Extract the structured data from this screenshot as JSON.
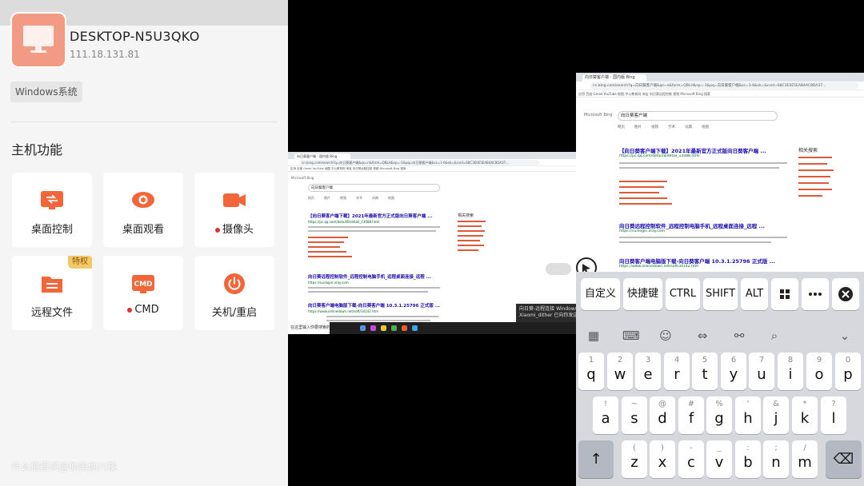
{
  "host": {
    "name": "DESKTOP-N5U3QKO",
    "ip": "111.18.131.81",
    "os_tag": "Windows系统",
    "icon": "monitor-icon"
  },
  "functions": {
    "title": "主机功能",
    "items": [
      {
        "label": "桌面控制",
        "icon": "desktop-control-icon"
      },
      {
        "label": "桌面观看",
        "icon": "eye-icon"
      },
      {
        "label": "摄像头",
        "icon": "camera-icon"
      },
      {
        "label": "远程文件",
        "icon": "folder-icon",
        "badge": "特权"
      },
      {
        "label": "CMD",
        "icon": "cmd-icon"
      },
      {
        "label": "关机/重启",
        "icon": "power-icon"
      }
    ]
  },
  "watermark": "什么值得买@你美你八筷",
  "colors": {
    "accent": "#f2663a",
    "icon_bg": "#f39a84",
    "status_dot": "#e0323a",
    "badge": "#f3c867"
  },
  "desktop": {
    "tab_title": "向日葵客户端 - 国内版 Bing",
    "url": "cn.bing.com/search?q=向日葵客户端&qs=n&form=QBLH&sp=-1&pq=向日葵客户端&sc=1-6&sk=&cvid=68C3E0E5EAB4AC8DA37...",
    "bookmarks": "应用  百度  Gmail  YouTube  地图  中公教育网  淘宝  向日葵远程控制  视频  Microsoft Bing 搜索",
    "engine": "Microsoft Bing",
    "query": "向日葵客户端",
    "nav_tabs": [
      "网页",
      "图片",
      "视频",
      "学术",
      "词典",
      "地图"
    ],
    "results": [
      {
        "title": "【向日葵客户端下载】2021年最新官方正式版向日葵客户端 ...",
        "url": "https://pc.qq.com/detail/8/detail_13088.html"
      },
      {
        "title": "向日葵远程控制软件_远程控制电脑手机_远程桌面连接_远程 ...",
        "url": "https://sunlogin.oray.com"
      },
      {
        "title": "向日葵客户端电脑版下载-向日葵客户端 10.3.1.25796 正式版 ...",
        "url": "https://www.onlinedown.net/soft/34142.htm"
      }
    ],
    "related_heading": "相关搜索",
    "taskbar_search": "在这里输入你要搜索的内容",
    "notify": "向日葵-远程连接 Windows...",
    "notify_sub": "Xiaomi_dither 已向你发送了消息"
  },
  "keyboard": {
    "function_keys": [
      "自定义",
      "快捷键",
      "CTRL",
      "SHIFT",
      "ALT",
      "win-key-icon",
      "more-icon",
      "close-circle-icon"
    ],
    "toolbar_icons": [
      "grid-icon",
      "keyboard-icon",
      "emoji-icon",
      "cursor-move-icon",
      "link-icon",
      "search-icon",
      "chevron-down-icon"
    ],
    "row1": [
      {
        "alt": "1",
        "main": "q"
      },
      {
        "alt": "2",
        "main": "w"
      },
      {
        "alt": "3",
        "main": "e"
      },
      {
        "alt": "4",
        "main": "r"
      },
      {
        "alt": "5",
        "main": "t"
      },
      {
        "alt": "6",
        "main": "y"
      },
      {
        "alt": "7",
        "main": "u"
      },
      {
        "alt": "8",
        "main": "i"
      },
      {
        "alt": "9",
        "main": "o"
      },
      {
        "alt": "0",
        "main": "p"
      }
    ],
    "row2": [
      {
        "alt": "!",
        "main": "a"
      },
      {
        "alt": "~",
        "main": "s"
      },
      {
        "alt": "@",
        "main": "d"
      },
      {
        "alt": "#",
        "main": "f"
      },
      {
        "alt": "%",
        "main": "g"
      },
      {
        "alt": "'",
        "main": "h"
      },
      {
        "alt": "&",
        "main": "j"
      },
      {
        "alt": "*",
        "main": "k"
      },
      {
        "alt": "?",
        "main": "l"
      }
    ],
    "row3": [
      {
        "alt": "(",
        "main": "z"
      },
      {
        "alt": ")",
        "main": "x"
      },
      {
        "alt": "-",
        "main": "c"
      },
      {
        "alt": "_",
        "main": "v"
      },
      {
        "alt": ":",
        "main": "b"
      },
      {
        "alt": ";",
        "main": "n"
      },
      {
        "alt": "/",
        "main": "m"
      }
    ],
    "shift_glyph": "↑",
    "backspace_glyph": "⌫"
  }
}
